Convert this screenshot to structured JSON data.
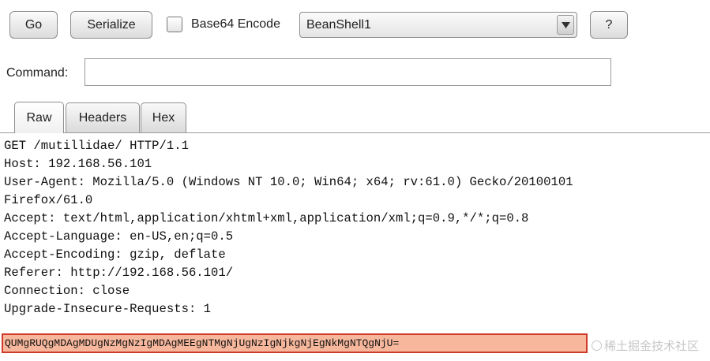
{
  "toolbar": {
    "go_label": "Go",
    "serialize_label": "Serialize",
    "base64_label": "Base64 Encode",
    "base64_checked": false,
    "interpreter_selected": "BeanShell1",
    "help_label": "?"
  },
  "command": {
    "label": "Command:",
    "value": ""
  },
  "tabs": [
    {
      "label": "Raw",
      "active": true
    },
    {
      "label": "Headers",
      "active": false
    },
    {
      "label": "Hex",
      "active": false
    }
  ],
  "request": {
    "lines": [
      "GET /mutillidae/ HTTP/1.1",
      "Host: 192.168.56.101",
      "User-Agent: Mozilla/5.0 (Windows NT 10.0; Win64; x64; rv:61.0) Gecko/20100101",
      "Firefox/61.0",
      "Accept: text/html,application/xhtml+xml,application/xml;q=0.9,*/*;q=0.8",
      "Accept-Language: en-US,en;q=0.5",
      "Accept-Encoding: gzip, deflate",
      "Referer: http://192.168.56.101/",
      "Connection: close",
      "Upgrade-Insecure-Requests: 1"
    ],
    "payload": "QUMgRUQgMDAgMDUgNzMgNzIgMDAgMEEgNTMgNjUgNzIgNjkgNjEgNkMgNTQgNjU=",
    "payload_highlight_color": "#f6b79c",
    "payload_border_color": "#d03a2a"
  },
  "watermark": {
    "text": "稀土掘金技术社区",
    "icon": "juejin-logo-icon"
  }
}
